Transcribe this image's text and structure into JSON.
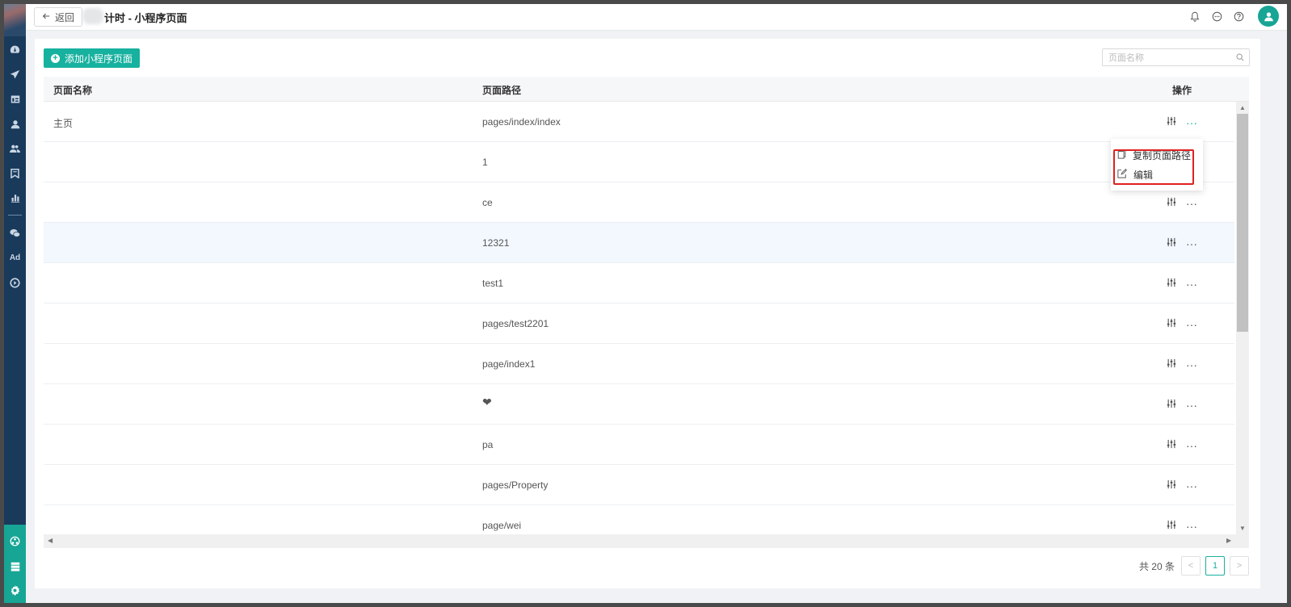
{
  "header": {
    "back_label": "返回",
    "title": "计时 - 小程序页面",
    "icons": [
      "bell-icon",
      "message-icon",
      "help-icon"
    ]
  },
  "sidebar": {
    "items": [
      "dashboard-icon",
      "send-icon",
      "layout-icon",
      "user-icon",
      "users-icon",
      "bookmark-icon",
      "bar-chart-icon",
      "wechat-icon",
      "ad-icon",
      "play-icon"
    ],
    "ad_label": "Ad",
    "bottom_items": [
      "network-icon",
      "server-icon",
      "settings-icon"
    ]
  },
  "toolbar": {
    "add_label": "添加小程序页面",
    "search_placeholder": "页面名称"
  },
  "table": {
    "headers": {
      "name": "页面名称",
      "path": "页面路径",
      "ops": "操作"
    },
    "rows": [
      {
        "name": "主页",
        "path": "pages/index/index"
      },
      {
        "name": "",
        "path": "1"
      },
      {
        "name": "",
        "path": "ce"
      },
      {
        "name": "",
        "path": "12321"
      },
      {
        "name": "",
        "path": "test1"
      },
      {
        "name": "",
        "path": "pages/test2201"
      },
      {
        "name": "",
        "path": "page/index1"
      },
      {
        "name": "",
        "path": "❤"
      },
      {
        "name": "",
        "path": "pa"
      },
      {
        "name": "",
        "path": "pages/Property"
      },
      {
        "name": "",
        "path": "page/wei"
      }
    ]
  },
  "dropdown": {
    "copy_label": "复制页面路径",
    "edit_label": "编辑"
  },
  "pagination": {
    "total_label": "共 20 条",
    "current_page": "1"
  },
  "colors": {
    "accent": "#17b19f",
    "sidebar": "#1a3a5c",
    "highlight": "#e02020"
  }
}
